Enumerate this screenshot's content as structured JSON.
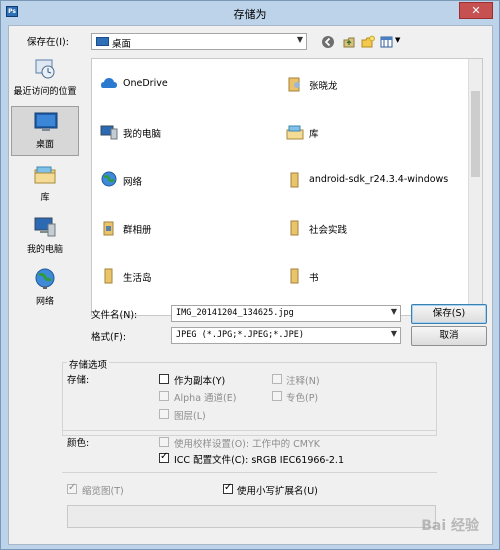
{
  "window": {
    "app_icon": "Ps",
    "title": "存储为",
    "close": "✕"
  },
  "save_in": {
    "label": "保存在(I):",
    "value": "桌面"
  },
  "places": [
    {
      "label": "最近访问的位置",
      "icon": "recent-places-icon"
    },
    {
      "label": "桌面",
      "icon": "desktop-icon"
    },
    {
      "label": "库",
      "icon": "library-icon"
    },
    {
      "label": "我的电脑",
      "icon": "computer-icon"
    },
    {
      "label": "网络",
      "icon": "network-icon"
    }
  ],
  "files": [
    {
      "name": "OneDrive",
      "icon": "onedrive-icon"
    },
    {
      "name": "张晓龙",
      "icon": "user-folder-icon"
    },
    {
      "name": "我的电脑",
      "icon": "computer-icon"
    },
    {
      "name": "库",
      "icon": "library-icon"
    },
    {
      "name": "网络",
      "icon": "network-icon"
    },
    {
      "name": "android-sdk_r24.3.4-windows",
      "icon": "folder-icon"
    },
    {
      "name": "群相册",
      "icon": "folder-icon"
    },
    {
      "name": "社会实践",
      "icon": "folder-icon"
    },
    {
      "name": "生活岛",
      "icon": "folder-icon"
    },
    {
      "name": "书",
      "icon": "folder-icon"
    }
  ],
  "filename": {
    "label": "文件名(N):",
    "value": "IMG_20141204_134625.jpg"
  },
  "format": {
    "label": "格式(F):",
    "value": "JPEG (*.JPG;*.JPEG;*.JPE)"
  },
  "buttons": {
    "save": "保存(S)",
    "cancel": "取消"
  },
  "options": {
    "group_title": "存储选项",
    "store_label": "存储:",
    "as_copy": "作为副本(Y)",
    "notes": "注释(N)",
    "alpha": "Alpha 通道(E)",
    "spot": "专色(P)",
    "layers": "图层(L)"
  },
  "color": {
    "label": "颜色:",
    "use_proof": "使用校样设置(O):  工作中的 CMYK",
    "icc": "ICC 配置文件(C):  sRGB IEC61966-2.1"
  },
  "thumbnail": "缩览图(T)",
  "lowercase_ext": "使用小写扩展名(U)",
  "watermark": "Bai 经验"
}
